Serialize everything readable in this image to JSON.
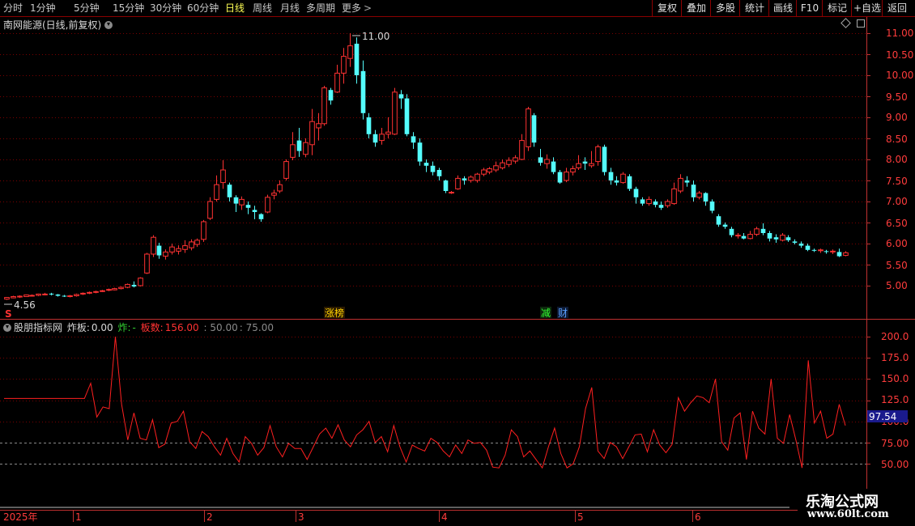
{
  "toolbar": {
    "periods": [
      "分时",
      "1分钟",
      "5分钟",
      "15分钟",
      "30分钟",
      "60分钟",
      "日线",
      "周线",
      "月线",
      "多周期",
      "更多"
    ],
    "active_period": "日线",
    "more_arrow": ">",
    "right_buttons": [
      "复权",
      "叠加",
      "多股",
      "统计",
      "画线",
      "F10",
      "标记",
      "+自选",
      "返回"
    ]
  },
  "price_panel": {
    "title": "南网能源(日线,前复权)",
    "high_label": "11.00",
    "low_label": "4.56",
    "y_ticks": [
      "11.00",
      "10.50",
      "10.00",
      "9.50",
      "9.00",
      "8.50",
      "8.00",
      "7.50",
      "7.00",
      "6.50",
      "6.00",
      "5.50",
      "5.00"
    ],
    "badges": {
      "zhangbang": "涨榜",
      "jian": "减",
      "cai": "财",
      "s": "S"
    }
  },
  "indicator": {
    "name": "股朋指标网",
    "zhaban_label": "炸板:",
    "zhaban_value": "0.00",
    "zha_label": "炸:",
    "zha_value": "-",
    "banshu_label": "板数:",
    "banshu_value": "156.00",
    "level1": ": 50.00",
    "level2": ": 75.00",
    "y_ticks": [
      "200.0",
      "175.0",
      "150.0",
      "125.0",
      "100.0",
      "75.00",
      "50.00"
    ],
    "current_value": "97.54"
  },
  "time_axis": {
    "year": "2025年",
    "months": [
      "1",
      "2",
      "3",
      "4",
      "5",
      "6"
    ]
  },
  "watermark": {
    "line1": "乐淘公式网",
    "line2": "www.60lt.com"
  },
  "colors": {
    "up": "#ff3232",
    "down": "#54fcfc",
    "grid": "#8b0000",
    "axis": "#c03030",
    "bg": "#000000"
  },
  "chart_data": [
    {
      "type": "candlestick",
      "title": "南网能源(日线,前复权)",
      "ylim": [
        4.56,
        11.2
      ],
      "candles": [
        [
          4.68,
          4.72,
          4.66,
          4.73
        ],
        [
          4.71,
          4.74,
          4.7,
          4.76
        ],
        [
          4.73,
          4.75,
          4.71,
          4.77
        ],
        [
          4.74,
          4.78,
          4.73,
          4.79
        ],
        [
          4.76,
          4.77,
          4.74,
          4.79
        ],
        [
          4.77,
          4.8,
          4.75,
          4.81
        ],
        [
          4.79,
          4.8,
          4.77,
          4.83
        ],
        [
          4.81,
          4.79,
          4.77,
          4.83
        ],
        [
          4.79,
          4.76,
          4.74,
          4.8
        ],
        [
          4.76,
          4.75,
          4.73,
          4.78
        ],
        [
          4.74,
          4.76,
          4.72,
          4.78
        ],
        [
          4.76,
          4.79,
          4.74,
          4.81
        ],
        [
          4.8,
          4.82,
          4.78,
          4.84
        ],
        [
          4.82,
          4.84,
          4.8,
          4.86
        ],
        [
          4.84,
          4.86,
          4.82,
          4.88
        ],
        [
          4.87,
          4.88,
          4.85,
          4.9
        ],
        [
          4.89,
          4.91,
          4.87,
          4.93
        ],
        [
          4.9,
          4.93,
          4.89,
          4.95
        ],
        [
          4.93,
          4.96,
          4.91,
          4.98
        ],
        [
          4.96,
          5.03,
          4.94,
          5.05
        ],
        [
          5.02,
          4.98,
          4.96,
          5.1
        ],
        [
          5.0,
          5.18,
          4.98,
          5.2
        ],
        [
          5.3,
          5.75,
          5.28,
          5.78
        ],
        [
          5.75,
          6.15,
          5.68,
          6.2
        ],
        [
          5.95,
          5.72,
          5.64,
          6.02
        ],
        [
          5.7,
          5.8,
          5.62,
          5.86
        ],
        [
          5.8,
          5.92,
          5.74,
          6.0
        ],
        [
          5.82,
          5.88,
          5.74,
          5.96
        ],
        [
          5.86,
          5.95,
          5.78,
          6.08
        ],
        [
          5.9,
          6.04,
          5.84,
          6.1
        ],
        [
          5.98,
          6.08,
          5.92,
          6.12
        ],
        [
          6.1,
          6.52,
          6.04,
          6.56
        ],
        [
          6.6,
          7.0,
          6.56,
          7.1
        ],
        [
          7.05,
          7.4,
          7.0,
          7.62
        ],
        [
          7.45,
          7.75,
          7.3,
          7.98
        ],
        [
          7.4,
          7.1,
          7.0,
          7.45
        ],
        [
          7.1,
          6.95,
          6.75,
          7.15
        ],
        [
          6.92,
          7.05,
          6.8,
          7.12
        ],
        [
          6.92,
          6.85,
          6.7,
          7.0
        ],
        [
          6.8,
          6.75,
          6.58,
          6.9
        ],
        [
          6.7,
          6.58,
          6.52,
          6.72
        ],
        [
          6.75,
          7.1,
          6.72,
          7.16
        ],
        [
          7.15,
          7.2,
          7.05,
          7.28
        ],
        [
          7.25,
          7.4,
          7.2,
          7.5
        ],
        [
          7.55,
          7.95,
          7.5,
          8.0
        ],
        [
          8.05,
          8.35,
          7.98,
          8.65
        ],
        [
          8.45,
          8.2,
          8.06,
          8.75
        ],
        [
          8.12,
          8.4,
          8.05,
          8.5
        ],
        [
          8.35,
          8.9,
          8.1,
          9.2
        ],
        [
          8.75,
          8.85,
          8.45,
          9.1
        ],
        [
          8.85,
          9.7,
          8.8,
          9.75
        ],
        [
          9.65,
          9.4,
          9.3,
          9.7
        ],
        [
          9.6,
          10.05,
          9.58,
          10.25
        ],
        [
          10.05,
          10.45,
          9.8,
          10.65
        ],
        [
          10.4,
          10.7,
          10.2,
          11.0
        ],
        [
          10.75,
          10.0,
          9.8,
          10.9
        ],
        [
          10.1,
          9.1,
          8.95,
          10.35
        ],
        [
          9.0,
          8.6,
          8.5,
          9.1
        ],
        [
          8.6,
          8.4,
          8.3,
          8.7
        ],
        [
          8.45,
          8.6,
          8.35,
          8.75
        ],
        [
          8.6,
          8.65,
          8.5,
          9.0
        ],
        [
          8.6,
          9.6,
          8.58,
          9.7
        ],
        [
          9.55,
          9.45,
          9.2,
          9.65
        ],
        [
          9.45,
          8.6,
          8.55,
          9.55
        ],
        [
          8.55,
          8.4,
          8.25,
          8.65
        ],
        [
          8.4,
          7.95,
          7.85,
          8.5
        ],
        [
          7.92,
          7.85,
          7.7,
          8.0
        ],
        [
          7.85,
          7.7,
          7.62,
          7.95
        ],
        [
          7.75,
          7.6,
          7.5,
          7.8
        ],
        [
          7.5,
          7.25,
          7.2,
          7.52
        ],
        [
          7.2,
          7.22,
          7.18,
          7.25
        ],
        [
          7.3,
          7.55,
          7.28,
          7.62
        ],
        [
          7.55,
          7.5,
          7.4,
          7.6
        ],
        [
          7.5,
          7.58,
          7.45,
          7.62
        ],
        [
          7.5,
          7.65,
          7.45,
          7.68
        ],
        [
          7.65,
          7.75,
          7.6,
          7.8
        ],
        [
          7.7,
          7.78,
          7.65,
          7.82
        ],
        [
          7.75,
          7.85,
          7.7,
          7.95
        ],
        [
          7.8,
          7.92,
          7.76,
          8.0
        ],
        [
          7.88,
          7.98,
          7.82,
          8.05
        ],
        [
          7.96,
          8.04,
          7.9,
          8.1
        ],
        [
          8.0,
          8.45,
          7.98,
          8.6
        ],
        [
          8.3,
          9.2,
          8.2,
          9.25
        ],
        [
          9.05,
          8.4,
          8.3,
          9.1
        ],
        [
          8.05,
          7.92,
          7.85,
          8.25
        ],
        [
          7.9,
          8.0,
          7.78,
          8.12
        ],
        [
          7.95,
          7.7,
          7.65,
          8.05
        ],
        [
          7.7,
          7.45,
          7.42,
          7.75
        ],
        [
          7.5,
          7.7,
          7.46,
          7.8
        ],
        [
          7.7,
          7.78,
          7.62,
          7.85
        ],
        [
          7.8,
          7.9,
          7.75,
          8.1
        ],
        [
          7.95,
          7.9,
          7.75,
          8.05
        ],
        [
          7.85,
          7.9,
          7.8,
          8.2
        ],
        [
          7.95,
          8.3,
          7.85,
          8.35
        ],
        [
          8.3,
          7.7,
          7.62,
          8.35
        ],
        [
          7.7,
          7.5,
          7.4,
          7.8
        ],
        [
          7.5,
          7.45,
          7.38,
          7.6
        ],
        [
          7.45,
          7.65,
          7.42,
          7.7
        ],
        [
          7.6,
          7.3,
          7.25,
          7.65
        ],
        [
          7.3,
          7.1,
          6.95,
          7.35
        ],
        [
          7.05,
          6.95,
          6.9,
          7.1
        ],
        [
          6.95,
          7.05,
          6.9,
          7.12
        ],
        [
          7.0,
          6.92,
          6.86,
          7.05
        ],
        [
          6.92,
          6.85,
          6.8,
          7.0
        ],
        [
          6.9,
          7.0,
          6.85,
          7.05
        ],
        [
          6.95,
          7.3,
          6.92,
          7.45
        ],
        [
          7.25,
          7.55,
          7.2,
          7.65
        ],
        [
          7.5,
          7.45,
          7.35,
          7.6
        ],
        [
          7.4,
          7.1,
          7.0,
          7.5
        ],
        [
          7.1,
          7.2,
          7.05,
          7.25
        ],
        [
          7.2,
          7.0,
          6.9,
          7.22
        ],
        [
          7.0,
          6.78,
          6.72,
          7.05
        ],
        [
          6.65,
          6.45,
          6.4,
          6.7
        ],
        [
          6.45,
          6.4,
          6.35,
          6.5
        ],
        [
          6.35,
          6.2,
          6.15,
          6.4
        ],
        [
          6.2,
          6.2,
          6.12,
          6.25
        ],
        [
          6.18,
          6.12,
          6.1,
          6.25
        ],
        [
          6.12,
          6.22,
          6.1,
          6.3
        ],
        [
          6.22,
          6.35,
          6.18,
          6.4
        ],
        [
          6.35,
          6.25,
          6.2,
          6.48
        ],
        [
          6.25,
          6.12,
          6.05,
          6.3
        ],
        [
          6.15,
          6.1,
          6.02,
          6.22
        ],
        [
          6.08,
          6.2,
          6.05,
          6.25
        ],
        [
          6.15,
          6.08,
          6.04,
          6.2
        ],
        [
          6.05,
          6.02,
          5.98,
          6.1
        ],
        [
          6.0,
          5.95,
          5.9,
          6.05
        ],
        [
          5.95,
          5.85,
          5.82,
          6.0
        ],
        [
          5.85,
          5.83,
          5.8,
          5.88
        ],
        [
          5.83,
          5.85,
          5.78,
          5.88
        ],
        [
          5.82,
          5.8,
          5.76,
          5.85
        ],
        [
          5.8,
          5.82,
          5.75,
          5.86
        ],
        [
          5.8,
          5.7,
          5.68,
          5.88
        ],
        [
          5.72,
          5.78,
          5.7,
          5.82
        ]
      ]
    },
    {
      "type": "line",
      "name": "股朋指标网",
      "ylim": [
        35,
        210
      ],
      "levels": [
        50,
        75
      ],
      "x_index": [
        0,
        1,
        2,
        3,
        4,
        5,
        6,
        7,
        8,
        9,
        10,
        11,
        12,
        13,
        14,
        15,
        16,
        17,
        18,
        19,
        20,
        21,
        22,
        23,
        24,
        25,
        26,
        27,
        28,
        29,
        30,
        31,
        32,
        33,
        34,
        35,
        36,
        37,
        38,
        39,
        40,
        41,
        42,
        43,
        44,
        45,
        46,
        47,
        48,
        49,
        50,
        51,
        52,
        53,
        54,
        55,
        56,
        57,
        58,
        59,
        60,
        61,
        62,
        63,
        64,
        65,
        66,
        67,
        68,
        69,
        70,
        71,
        72,
        73,
        74,
        75,
        76,
        77,
        78,
        79,
        80,
        81,
        82,
        83,
        84,
        85,
        86,
        87,
        88,
        89,
        90,
        91,
        92,
        93,
        94,
        95,
        96,
        97,
        98,
        99,
        100,
        101,
        102,
        103,
        104,
        105,
        106,
        107,
        108,
        109,
        110,
        111,
        112,
        113,
        114,
        115,
        116,
        117,
        118,
        119,
        120,
        121,
        122,
        123,
        124,
        125,
        126,
        127,
        128,
        129,
        130,
        131,
        132,
        133,
        134,
        135,
        136
      ],
      "values": [
        127,
        127,
        127,
        127,
        127,
        127,
        127,
        127,
        127,
        127,
        127,
        127,
        127,
        127,
        145,
        105,
        117,
        115,
        200,
        120,
        78,
        110,
        80,
        78,
        102,
        69,
        73,
        98,
        100,
        112,
        76,
        68,
        88,
        82,
        70,
        60,
        80,
        62,
        52,
        82,
        74,
        60,
        69,
        95,
        70,
        58,
        74,
        68,
        68,
        55,
        70,
        85,
        92,
        80,
        96,
        78,
        70,
        84,
        90,
        100,
        75,
        82,
        64,
        95,
        70,
        52,
        72,
        68,
        65,
        80,
        75,
        65,
        58,
        72,
        62,
        78,
        74,
        75,
        66,
        46,
        45,
        60,
        90,
        82,
        58,
        65,
        55,
        45,
        70,
        92,
        62,
        45,
        50,
        70,
        115,
        140,
        65,
        56,
        75,
        70,
        56,
        70,
        84,
        85,
        64,
        90,
        72,
        63,
        73,
        128,
        112,
        122,
        130,
        128,
        122,
        150,
        76,
        66,
        104,
        110,
        55,
        112,
        92,
        85,
        150,
        80,
        74,
        108,
        78,
        45,
        172,
        98,
        112,
        80,
        85,
        120,
        95
      ]
    }
  ]
}
